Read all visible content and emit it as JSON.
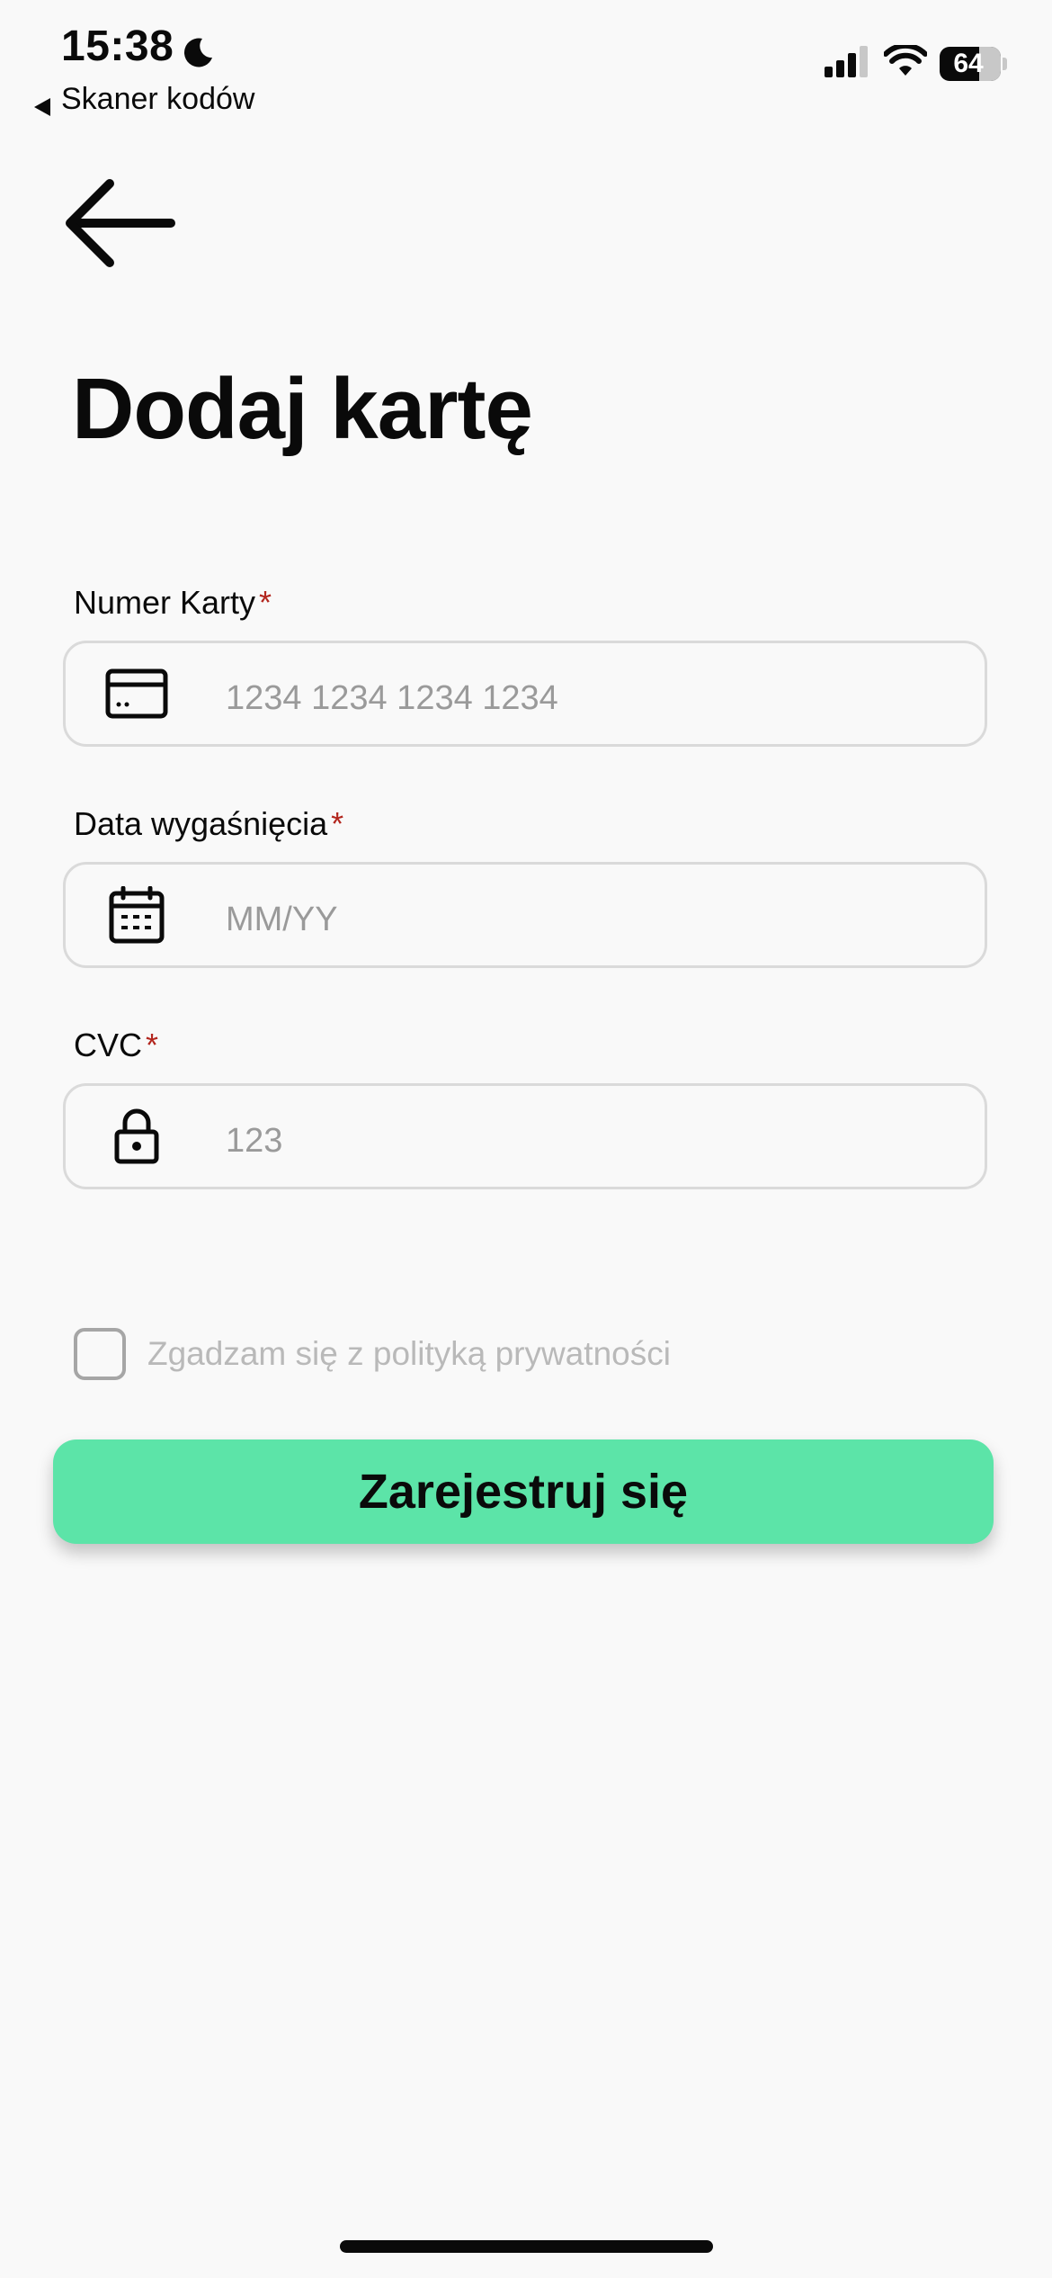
{
  "status_bar": {
    "time": "15:38",
    "back_app_label": "Skaner kodów",
    "battery_level": "64"
  },
  "header": {
    "title": "Dodaj kartę"
  },
  "form": {
    "card_number": {
      "label": "Numer Karty",
      "required_mark": "*",
      "placeholder": "1234 1234 1234 1234",
      "value": "",
      "icon": "credit-card-icon"
    },
    "expiry": {
      "label": "Data wygaśnięcia",
      "required_mark": "*",
      "placeholder": "MM/YY",
      "value": "",
      "icon": "calendar-icon"
    },
    "cvc": {
      "label": "CVC",
      "required_mark": "*",
      "placeholder": "123",
      "value": "",
      "icon": "lock-icon"
    },
    "consent": {
      "label": "Zgadzam się z polityką prywatności",
      "checked": false
    },
    "submit_label": "Zarejestruj się"
  },
  "colors": {
    "accent": "#5ce4a8",
    "required": "#b3261e",
    "background": "#f9f9f9",
    "placeholder": "#9a9a9a"
  }
}
